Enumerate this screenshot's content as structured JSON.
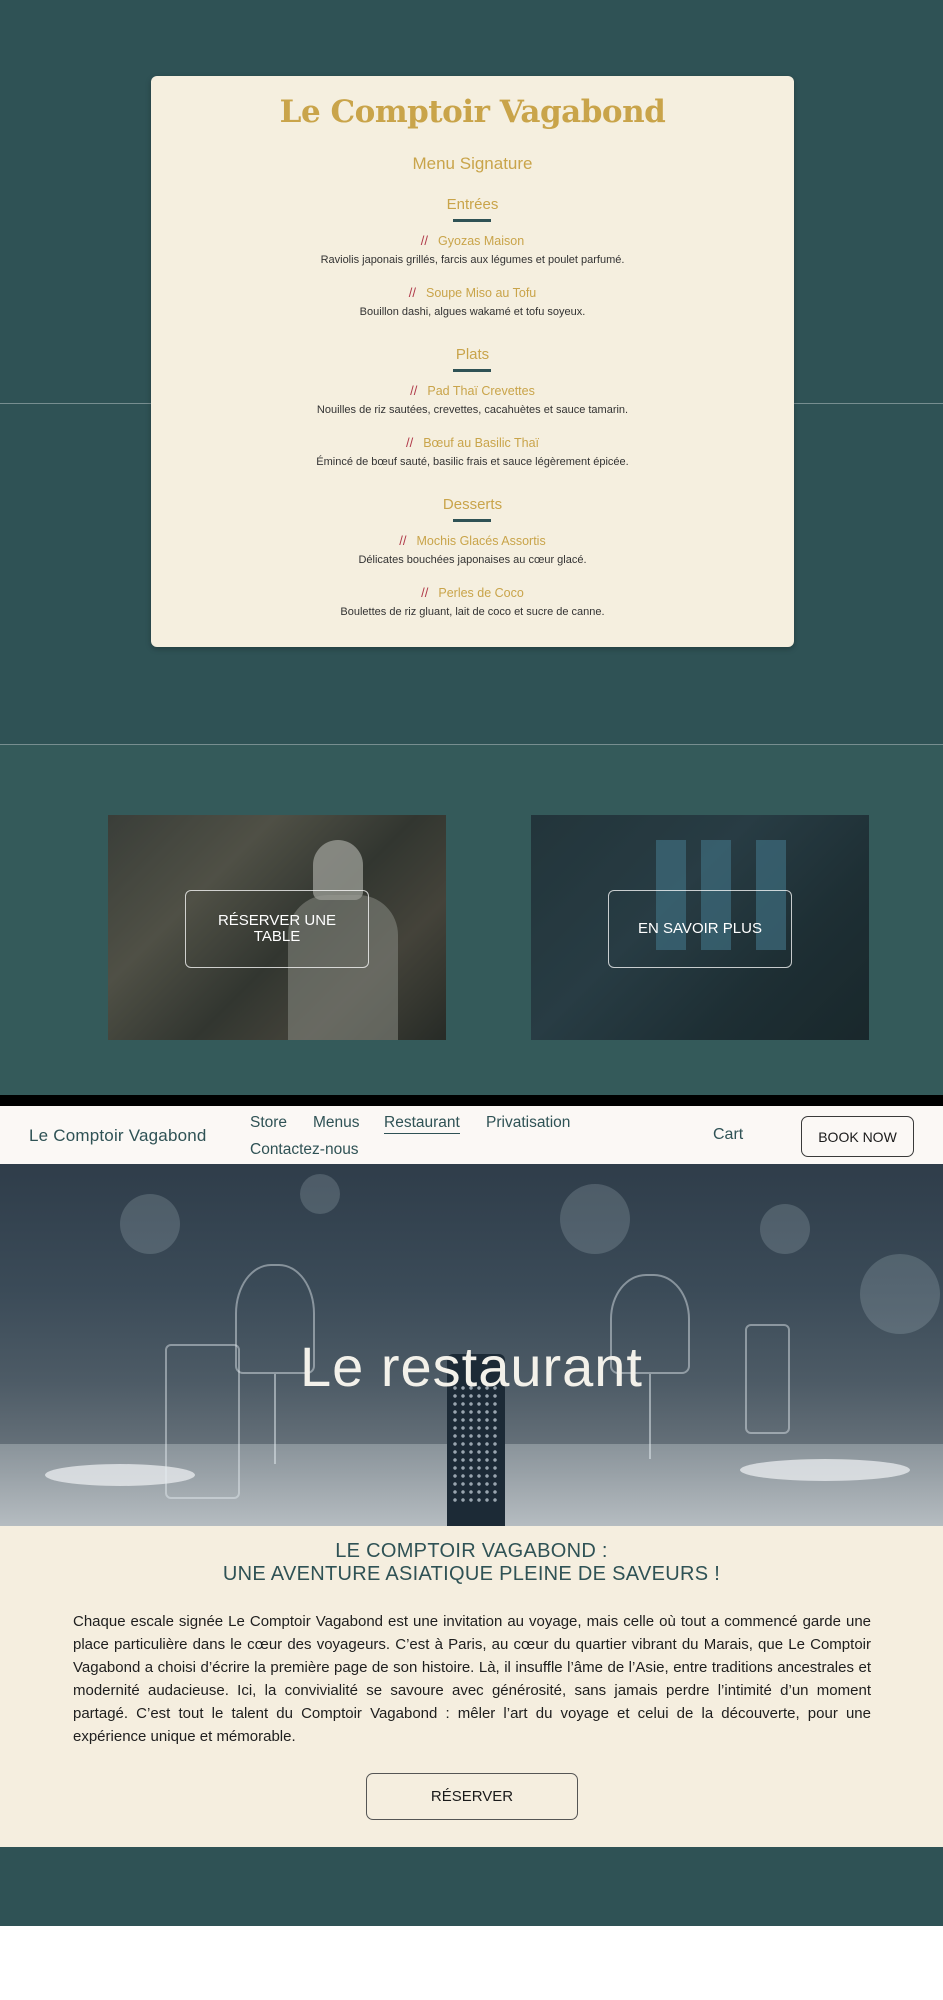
{
  "menu_card": {
    "title": "Le Comptoir Vagabond",
    "subtitle": "Menu Signature",
    "sections": [
      {
        "title": "Entrées",
        "items": [
          {
            "name": "Gyozas Maison",
            "description": "Raviolis japonais grillés, farcis aux légumes et poulet parfumé."
          },
          {
            "name": "Soupe Miso au Tofu",
            "description": "Bouillon dashi, algues wakamé et tofu soyeux."
          }
        ]
      },
      {
        "title": "Plats",
        "items": [
          {
            "name": "Pad Thaï Crevettes",
            "description": "Nouilles de riz sautées, crevettes, cacahuètes et sauce tamarin."
          },
          {
            "name": "Bœuf au Basilic Thaï",
            "description": "Émincé de bœuf sauté, basilic frais et sauce légèrement épicée."
          }
        ]
      },
      {
        "title": "Desserts",
        "items": [
          {
            "name": "Mochis Glacés Assortis",
            "description": "Délicates bouchées japonaises au cœur glacé."
          },
          {
            "name": "Perles de Coco",
            "description": "Boulettes de riz gluant, lait de coco et sucre de canne."
          }
        ]
      }
    ]
  },
  "cta_cards": {
    "left_label": "RÉSERVER UNE TABLE",
    "right_label": "EN SAVOIR PLUS"
  },
  "nav": {
    "logo": "Le Comptoir Vagabond",
    "links": [
      "Store",
      "Menus",
      "Restaurant",
      "Privatisation",
      "Contactez-nous"
    ],
    "active_link": "Restaurant",
    "cart": "Cart",
    "book": "BOOK NOW"
  },
  "hero": {
    "title": "Le restaurant"
  },
  "about": {
    "heading_line1": "LE COMPTOIR VAGABOND :",
    "heading_line2": "UNE AVENTURE ASIATIQUE PLEINE DE SAVEURS !",
    "body": "Chaque escale signée Le Comptoir Vagabond est une invitation au voyage, mais celle où tout a commencé garde une place particulière dans le cœur des voyageurs. C’est à Paris, au cœur du quartier vibrant du Marais, que Le Comptoir Vagabond a choisi d’écrire la première page de son histoire. Là, il insuffle l’âme de l’Asie, entre traditions ancestrales et modernité audacieuse. Ici, la convivialité se savoure avec générosité, sans jamais perdre l’intimité d’un moment partagé. C’est tout le talent du Comptoir Vagabond : mêler l’art du voyage et celui de la découverte, pour une expérience unique et mémorable.",
    "button": "RÉSERVER"
  },
  "colors": {
    "teal": "#2f5255",
    "gold": "#c9a44a",
    "cream": "#f5efdf",
    "chopsticks": "#b03a4a"
  }
}
